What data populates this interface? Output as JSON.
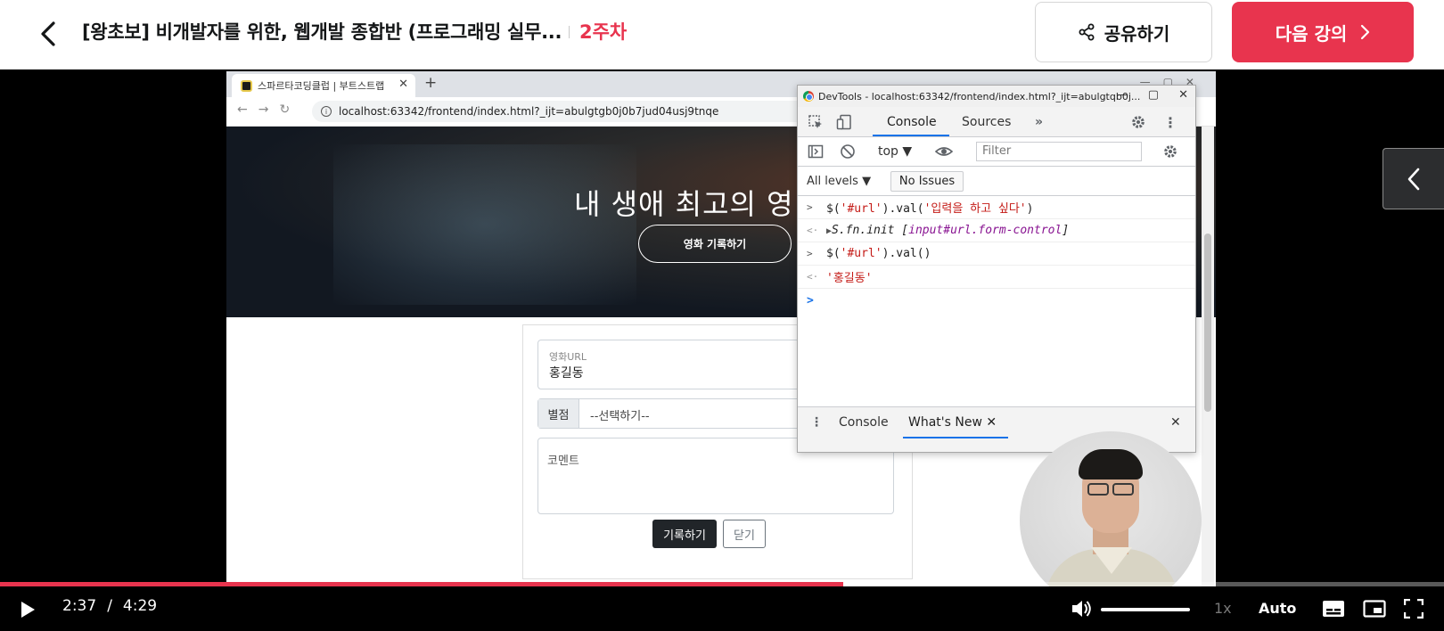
{
  "header": {
    "course_title": "[왕초보] 비개발자를 위한, 웹개발 종합반 (프로그래밍 실무...",
    "week": "2주차",
    "share_label": "공유하기",
    "next_label": "다음 강의"
  },
  "browser": {
    "tab_title": "스파르타코딩클럽 | 부트스트랩",
    "url": "localhost:63342/frontend/index.html?_ijt=abulgtgb0j0b7jud04usj9tnqe"
  },
  "webpage": {
    "hero_title": "내 생애 최고의 영",
    "hero_button": "영화 기록하기",
    "url_field_label": "영화URL",
    "url_field_value": "홍길동",
    "star_label": "별점",
    "star_select": "--선택하기--",
    "comment_placeholder": "코멘트",
    "submit_label": "기록하기",
    "close_label": "닫기"
  },
  "devtools": {
    "window_title": "DevTools - localhost:63342/frontend/index.html?_ijt=abulgtqb0j...",
    "tabs": [
      "Console",
      "Sources"
    ],
    "context": "top ▼",
    "filter_placeholder": "Filter",
    "levels": "All levels ▼",
    "issues": "No Issues",
    "console": [
      {
        "kind": "input",
        "fn": "$(",
        "s1": "'#url'",
        "fn2": ").val(",
        "s2": "'입력을 하고 싶다'",
        "end": ")"
      },
      {
        "kind": "output",
        "obj": "S.fn.init [",
        "sel": "input#url.form-control",
        "end": "]"
      },
      {
        "kind": "input",
        "fn": "$(",
        "s1": "'#url'",
        "fn2": ").val()",
        "s2": "",
        "end": ""
      },
      {
        "kind": "output-str",
        "value": "'홍길동'"
      }
    ],
    "drawer_tabs": [
      "Console",
      "What's New"
    ]
  },
  "player": {
    "current_time": "2:37",
    "duration": "4:29",
    "progress": 0.584,
    "speed": "1x",
    "quality": "Auto"
  },
  "colors": {
    "brand": "#e8344e",
    "devtools_accent": "#1a73e8",
    "string": "#c41a16"
  }
}
